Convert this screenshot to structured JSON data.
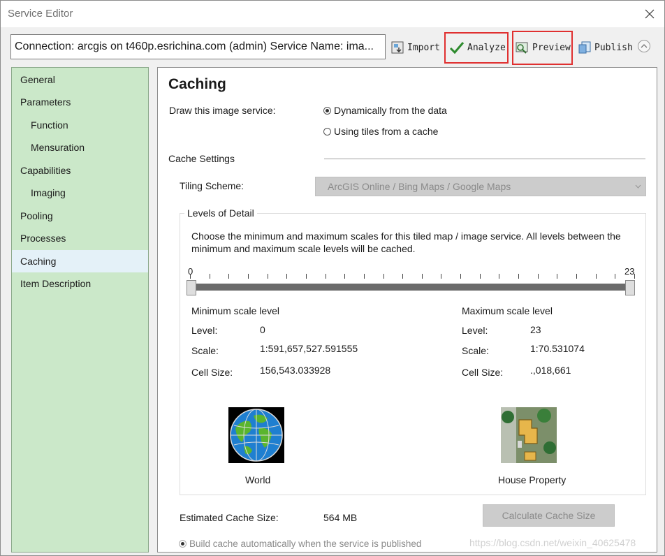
{
  "window": {
    "title": "Service Editor"
  },
  "toolbar": {
    "connection_text": "Connection: arcgis on t460p.esrichina.com (admin)    Service Name: ima...",
    "import_label": "Import",
    "analyze_label": "Analyze",
    "preview_label": "Preview",
    "publish_label": "Publish"
  },
  "sidebar": {
    "items": [
      {
        "label": "General"
      },
      {
        "label": "Parameters"
      },
      {
        "label": "Function"
      },
      {
        "label": "Mensuration"
      },
      {
        "label": "Capabilities"
      },
      {
        "label": "Imaging"
      },
      {
        "label": "Pooling"
      },
      {
        "label": "Processes"
      },
      {
        "label": "Caching",
        "selected": true
      },
      {
        "label": "Item Description"
      }
    ]
  },
  "caching": {
    "heading": "Caching",
    "draw_label": "Draw this image service:",
    "option_dynamic": "Dynamically from the data",
    "option_tiles": "Using tiles from a cache",
    "selected_option": "dynamic",
    "cache_settings_label": "Cache Settings",
    "tiling_scheme_label": "Tiling Scheme:",
    "tiling_scheme_value": "ArcGIS Online / Bing Maps / Google Maps",
    "levels_of_detail_label": "Levels of Detail",
    "description": "Choose the minimum and maximum scales for this tiled map / image service. All levels between the minimum and maximum scale levels will be cached.",
    "slider": {
      "min_label": "0",
      "max_label": "23",
      "low": 0,
      "high": 23,
      "min": 0,
      "max": 23
    },
    "min_scale": {
      "title": "Minimum scale level",
      "level_label": "Level:",
      "level_value": "0",
      "scale_label": "Scale:",
      "scale_value": "1:591,657,527.591555",
      "cellsize_label": "Cell Size:",
      "cellsize_value": "156,543.033928",
      "image_caption": "World"
    },
    "max_scale": {
      "title": "Maximum scale level",
      "level_label": "Level:",
      "level_value": "23",
      "scale_label": "Scale:",
      "scale_value": "1:70.531074",
      "cellsize_label": "Cell Size:",
      "cellsize_value": ".,018,661",
      "image_caption": "House Property"
    },
    "estimated_label": "Estimated Cache Size:",
    "estimated_value": "564 MB",
    "calc_button": "Calculate Cache Size",
    "build_auto_label": "Build cache automatically when the service is published"
  },
  "watermark": "https://blog.csdn.net/weixin_40625478",
  "colors": {
    "highlight": "#e03030",
    "sidebar_bg": "#cbe8c9",
    "selected_bg": "#e4f1f8"
  }
}
